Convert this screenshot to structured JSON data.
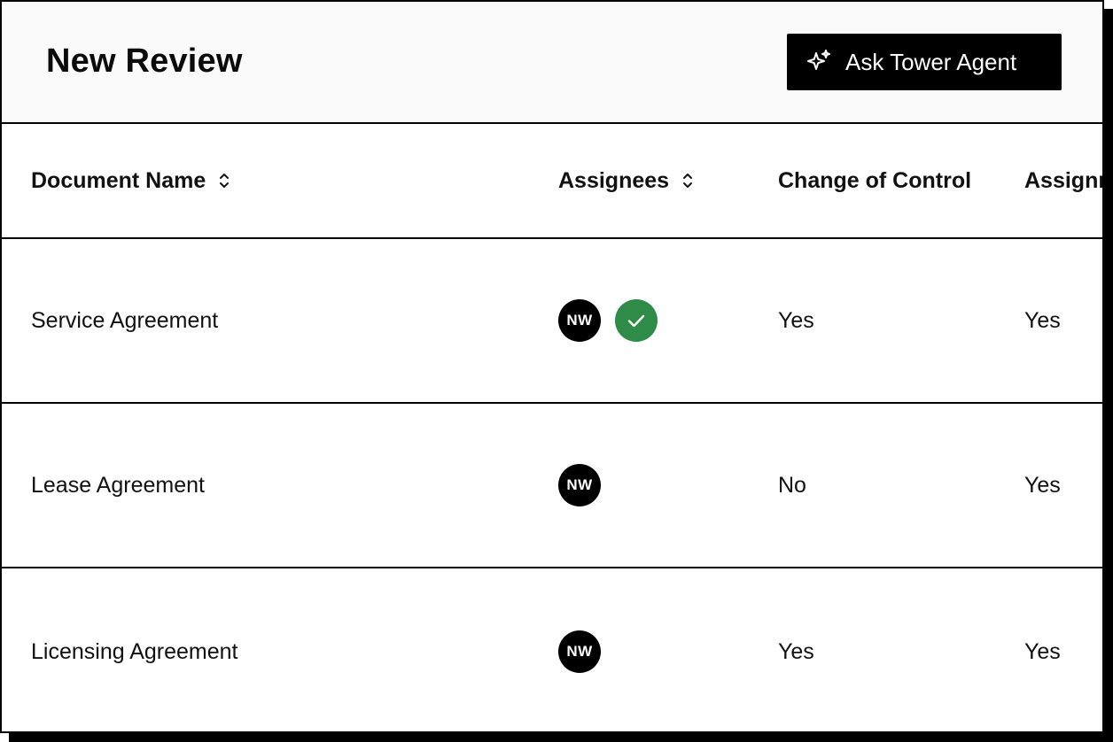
{
  "header": {
    "title": "New Review",
    "agent_button_label": "Ask Tower Agent",
    "agent_button_icon": "sparkles-icon"
  },
  "table": {
    "columns": [
      {
        "label": "Document Name",
        "sortable": true
      },
      {
        "label": "Assignees",
        "sortable": true
      },
      {
        "label": "Change of Control",
        "sortable": false
      },
      {
        "label": "Assignm",
        "sortable": false
      }
    ],
    "rows": [
      {
        "document": "Service Agreement",
        "assignee_initials": "NW",
        "approved": true,
        "change_of_control": "Yes",
        "assignment": "Yes"
      },
      {
        "document": "Lease Agreement",
        "assignee_initials": "NW",
        "approved": false,
        "change_of_control": "No",
        "assignment": "Yes"
      },
      {
        "document": "Licensing Agreement",
        "assignee_initials": "NW",
        "approved": false,
        "change_of_control": "Yes",
        "assignment": "Yes"
      }
    ]
  },
  "colors": {
    "approved_badge": "#2e8b48",
    "avatar_bg": "#000000",
    "header_bg": "#fafafa"
  }
}
